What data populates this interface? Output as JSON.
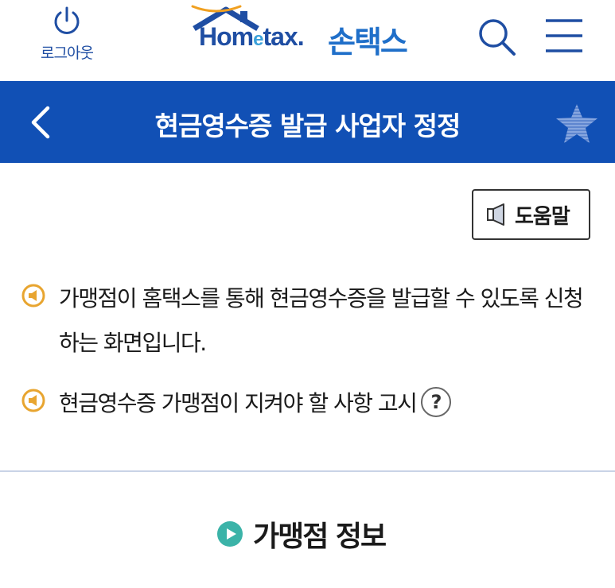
{
  "header": {
    "logout_label": "로그아웃",
    "logo_text_home": "Hom",
    "logo_text_e": "e",
    "logo_text_tax": "tax.",
    "logo_text_ko": "손택스"
  },
  "titlebar": {
    "title": "현금영수증 발급 사업자 정정"
  },
  "help": {
    "label": "도움말"
  },
  "notices": [
    {
      "text": "가맹점이 홈택스를 통해 현금영수증을 발급할 수 있도록 신청하는 화면입니다."
    },
    {
      "text": "현금영수증 가맹점이 지켜야 할 사항 고시",
      "help_mark": "?"
    }
  ],
  "section": {
    "title": "가맹점 정보"
  },
  "colors": {
    "brand_blue": "#1150b5",
    "logo_blue": "#1f4ea3",
    "bullet_orange": "#e8a530",
    "section_teal": "#3bb3a8"
  }
}
